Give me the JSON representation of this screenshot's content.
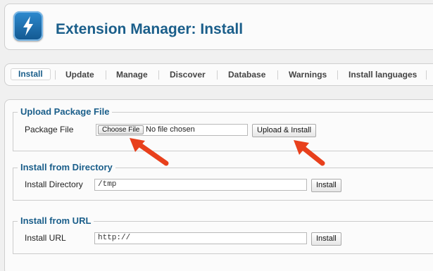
{
  "header": {
    "title": "Extension Manager: Install",
    "logo_icon": "joomla-lightning-icon"
  },
  "tabs": [
    {
      "label": "Install",
      "active": true
    },
    {
      "label": "Update"
    },
    {
      "label": "Manage"
    },
    {
      "label": "Discover"
    },
    {
      "label": "Database"
    },
    {
      "label": "Warnings"
    },
    {
      "label": "Install languages"
    }
  ],
  "upload": {
    "legend": "Upload Package File",
    "label": "Package File",
    "choose_label": "Choose File",
    "file_status": "No file chosen",
    "button": "Upload & Install"
  },
  "directory": {
    "legend": "Install from Directory",
    "label": "Install Directory",
    "value": "/tmp",
    "button": "Install"
  },
  "url": {
    "legend": "Install from URL",
    "label": "Install URL",
    "value": "http://",
    "button": "Install"
  },
  "colors": {
    "accent": "#1a5e8a",
    "arrow": "#e8401c"
  }
}
